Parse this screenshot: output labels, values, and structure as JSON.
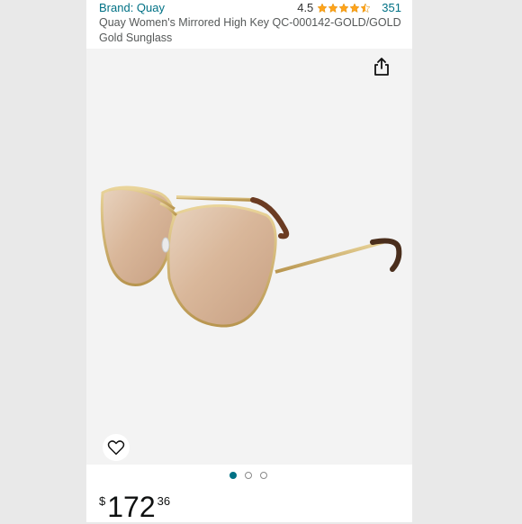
{
  "product": {
    "brand": "Brand: Quay",
    "rating": "4.5",
    "stars": 4.5,
    "review_count": "351",
    "title": "Quay Women's Mirrored High Key QC-000142-GOLD/GOLD Gold Sunglass"
  },
  "gallery": {
    "image_count": 3,
    "active_index": 0,
    "share_icon": "share-icon",
    "wishlist_icon": "heart-icon"
  },
  "price": {
    "symbol": "$",
    "whole": "172",
    "fraction": "36"
  },
  "colors": {
    "link": "#007185",
    "star": "#ffa41c",
    "text": "#0f1111",
    "muted": "#565959"
  }
}
